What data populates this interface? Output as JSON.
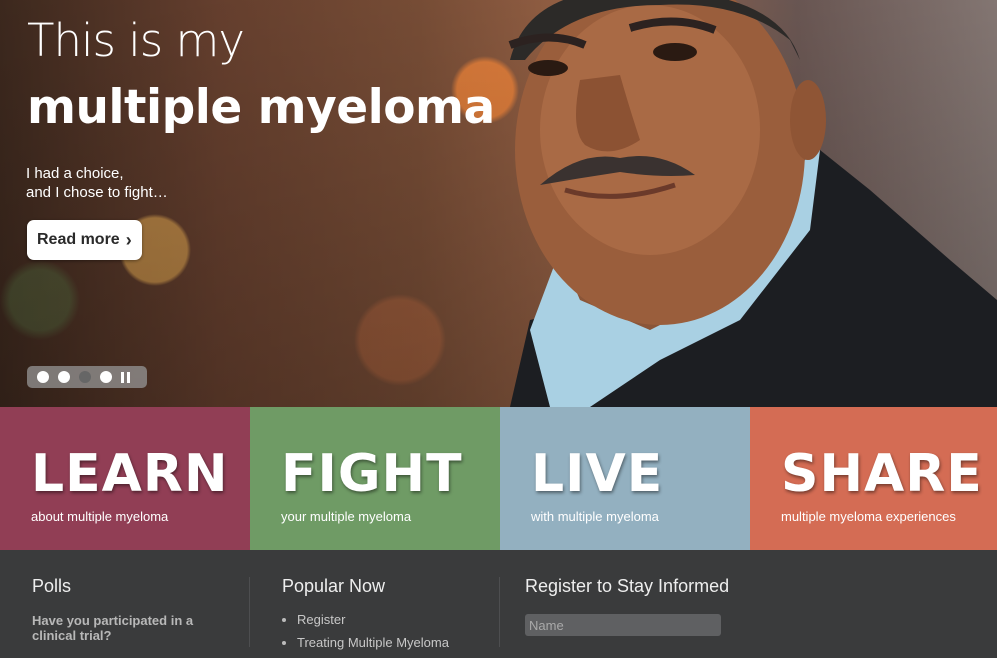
{
  "hero": {
    "title_line1": "This is my",
    "title_line2": "multiple myeloma",
    "subtitle_line1": "I had a choice,",
    "subtitle_line2": "and I chose to fight…",
    "read_more_label": "Read more",
    "read_more_icon": "chevron-right-icon",
    "slides": {
      "count": 4,
      "active_index": 2
    },
    "pause_icon": "pause-icon"
  },
  "tiles": [
    {
      "title": "LEARN",
      "subtitle": "about multiple myeloma",
      "color": "#913e55"
    },
    {
      "title": "FIGHT",
      "subtitle": "your multiple myeloma",
      "color": "#6f9b65"
    },
    {
      "title": "LIVE",
      "subtitle": "with multiple myeloma",
      "color": "#93b0c0"
    },
    {
      "title": "SHARE",
      "subtitle": "multiple myeloma experiences",
      "color": "#d46c54"
    }
  ],
  "polls": {
    "heading": "Polls",
    "question": "Have you participated in a clinical trial?"
  },
  "popular": {
    "heading": "Popular Now",
    "items": [
      "Register",
      "Treating Multiple Myeloma"
    ]
  },
  "register": {
    "heading": "Register to Stay Informed",
    "name_placeholder": "Name"
  }
}
